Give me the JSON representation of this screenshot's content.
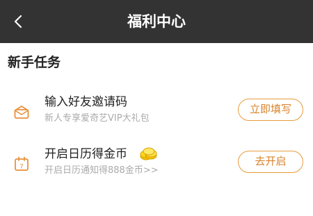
{
  "header": {
    "title": "福利中心",
    "back_icon": "chevron-left-icon",
    "background_color": "#333333"
  },
  "section": {
    "title": "新手任务"
  },
  "tasks": [
    {
      "icon": "envelope-icon",
      "title": "输入好友邀请码",
      "subtitle": "新人专享爱奇艺VIP大礼包",
      "button_label": "立即填写"
    },
    {
      "icon": "calendar-icon",
      "calendar_day": "7",
      "title": "开启日历得金币",
      "title_icon": "coin-stack-icon",
      "subtitle": "开启日历通知得888金币>>",
      "button_label": "去开启"
    }
  ],
  "colors": {
    "accent": "#e89a3c",
    "accent_text": "#d9822b",
    "coin": "#f5c400"
  }
}
